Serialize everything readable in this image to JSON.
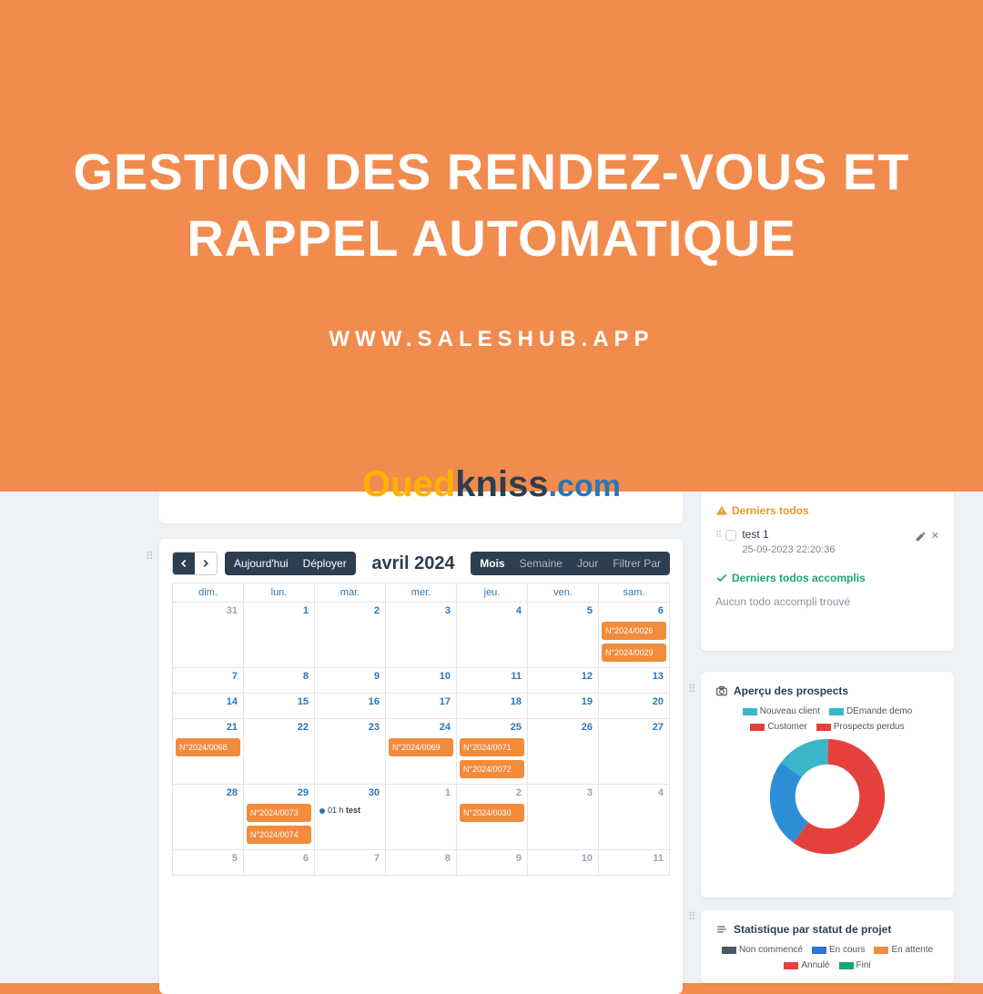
{
  "hero": {
    "title_line1": "GESTION DES RENDEZ-VOUS ET",
    "title_line2": "RAPPEL AUTOMATIQUE",
    "url": "WWW.SALESHUB.APP"
  },
  "watermark": {
    "a": "Oued",
    "b": "kniss",
    "c": ".com"
  },
  "calendar": {
    "today_label": "Aujourd'hui",
    "deploy_label": "Déployer",
    "title": "avril 2024",
    "views": {
      "month": "Mois",
      "week": "Semaine",
      "day": "Jour",
      "filter": "Filtrer Par"
    },
    "weekdays": [
      "dim.",
      "lun.",
      "mar.",
      "mer.",
      "jeu.",
      "ven.",
      "sam."
    ],
    "weeks": [
      {
        "days": [
          {
            "n": "31",
            "muted": true
          },
          {
            "n": "1"
          },
          {
            "n": "2"
          },
          {
            "n": "3"
          },
          {
            "n": "4"
          },
          {
            "n": "5"
          },
          {
            "n": "6",
            "events": [
              "N°2024/0026",
              "N°2024/0029"
            ]
          }
        ]
      },
      {
        "days": [
          {
            "n": "7"
          },
          {
            "n": "8"
          },
          {
            "n": "9"
          },
          {
            "n": "10"
          },
          {
            "n": "11"
          },
          {
            "n": "12"
          },
          {
            "n": "13"
          }
        ],
        "short": true
      },
      {
        "days": [
          {
            "n": "14"
          },
          {
            "n": "15"
          },
          {
            "n": "16"
          },
          {
            "n": "17"
          },
          {
            "n": "18"
          },
          {
            "n": "19"
          },
          {
            "n": "20"
          }
        ],
        "short": true
      },
      {
        "days": [
          {
            "n": "21",
            "events": [
              "N°2024/0068"
            ]
          },
          {
            "n": "22"
          },
          {
            "n": "23"
          },
          {
            "n": "24",
            "events": [
              "N°2024/0069"
            ]
          },
          {
            "n": "25",
            "events": [
              "N°2024/0071",
              "N°2024/0072"
            ]
          },
          {
            "n": "26"
          },
          {
            "n": "27"
          }
        ]
      },
      {
        "days": [
          {
            "n": "28"
          },
          {
            "n": "29",
            "events": [
              "N°2024/0073",
              "N°2024/0074"
            ]
          },
          {
            "n": "30",
            "timed": {
              "time": "01 h",
              "label": "test"
            }
          },
          {
            "n": "1",
            "muted": true
          },
          {
            "n": "2",
            "muted": true,
            "events": [
              "N°2024/0030"
            ]
          },
          {
            "n": "3",
            "muted": true
          },
          {
            "n": "4",
            "muted": true
          }
        ]
      },
      {
        "days": [
          {
            "n": "5",
            "muted": true
          },
          {
            "n": "6",
            "muted": true
          },
          {
            "n": "7",
            "muted": true
          },
          {
            "n": "8",
            "muted": true
          },
          {
            "n": "9",
            "muted": true
          },
          {
            "n": "10",
            "muted": true
          },
          {
            "n": "11",
            "muted": true
          }
        ],
        "short": true
      }
    ]
  },
  "todos": {
    "section1_label": "Derniers todos",
    "item_text": "test 1",
    "item_date": "25-09-2023 22:20:36",
    "section2_label": "Derniers todos accomplis",
    "empty_text": "Aucun todo accompli trouvé"
  },
  "prospects": {
    "title": "Aperçu des prospects",
    "legend": [
      {
        "label": "Nouveau client",
        "color": "#3bb6c9"
      },
      {
        "label": "DEmande demo",
        "color": "#3bb6c9"
      },
      {
        "label": "Customer",
        "color": "#e5413c"
      },
      {
        "label": "Prospects perdus",
        "color": "#e5413c"
      }
    ]
  },
  "status": {
    "title": "Statistique par statut de projet",
    "legend": [
      {
        "label": "Non commencé",
        "color": "#4a586a"
      },
      {
        "label": "En cours",
        "color": "#2c75d6"
      },
      {
        "label": "En attente",
        "color": "#f28b3b"
      },
      {
        "label": "Annulé",
        "color": "#e5413c"
      },
      {
        "label": "Fini",
        "color": "#1aa86b"
      }
    ]
  },
  "chart_data": {
    "type": "pie",
    "title": "Aperçu des prospects",
    "series": [
      {
        "name": "Nouveau client",
        "value": 15,
        "color": "#3bb6c9"
      },
      {
        "name": "DEmande demo",
        "value": 25,
        "color": "#2c8fd6"
      },
      {
        "name": "Customer / Prospects perdus",
        "value": 60,
        "color": "#e5413c"
      }
    ]
  }
}
